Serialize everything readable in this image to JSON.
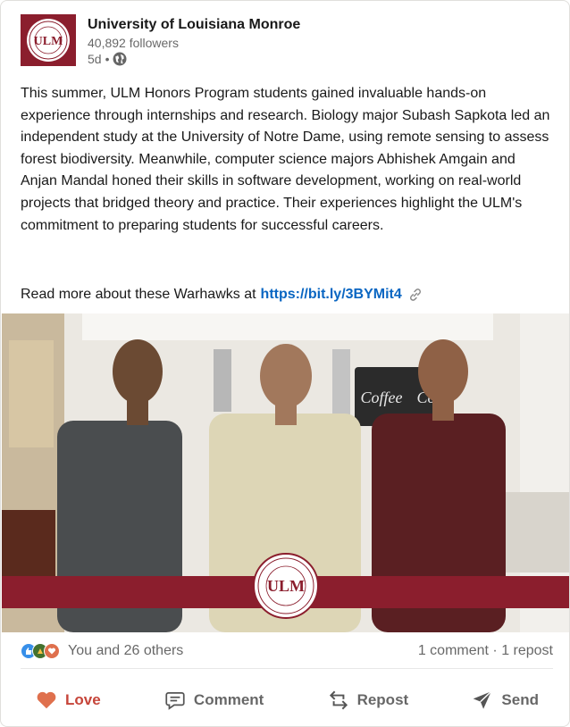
{
  "post": {
    "author": {
      "name": "University of Louisiana Monroe",
      "followers": "40,892 followers",
      "time": "5d",
      "logo_text": "ULM"
    },
    "body": "This summer, ULM Honors Program students gained invaluable hands-on experience through internships and research. Biology major Subash Sapkota led an independent study at the University of Notre Dame, using remote sensing to assess forest biodiversity. Meanwhile, computer science majors Abhishek Amgain and Anjan Mandal honed their skills in software development, working on real-world projects that bridged theory and practice. Their experiences highlight the ULM's commitment to preparing students for successful careers.",
    "read_more": "Read more about these Warhawks at",
    "link": "https://bit.ly/3BYMit4",
    "image": {
      "sign_text_1": "Coffee",
      "sign_text_2": "Co",
      "banner_logo_text": "ULM"
    }
  },
  "social": {
    "reactions_text": "You and 26 others",
    "comments": "1 comment",
    "separator": " · ",
    "reposts": "1 repost"
  },
  "actions": {
    "love": "Love",
    "comment": "Comment",
    "repost": "Repost",
    "send": "Send"
  },
  "colors": {
    "maroon": "#8b1e2d",
    "link": "#0a66c2",
    "love": "#c6453a",
    "like": "#378fe9",
    "celebrate": "#44712e",
    "heart": "#df704d"
  }
}
